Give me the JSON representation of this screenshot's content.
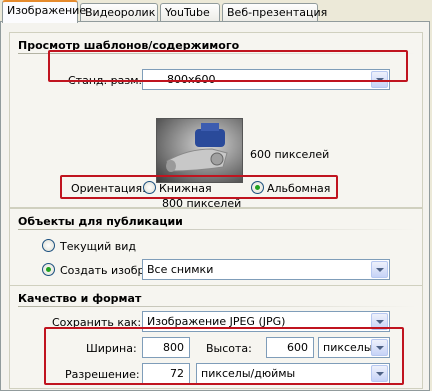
{
  "tabs": [
    {
      "label": "Изображение",
      "active": true
    },
    {
      "label": "Видеоролик",
      "active": false
    },
    {
      "label": "YouTube",
      "active": false
    },
    {
      "label": "Веб-презентация",
      "active": false
    }
  ],
  "preview": {
    "title": "Просмотр шаблонов/содержимого",
    "size_label": "Станд. разм.:",
    "size_value": "800x600",
    "height_text": "600 пикселей",
    "width_text": "800 пикселей",
    "orientation_label": "Ориентация:",
    "portrait": "Книжная",
    "landscape": "Альбомная",
    "selected": "Альбомная"
  },
  "publish": {
    "title": "Объекты для публикации",
    "current_view": "Текущий вид",
    "create_images": "Создать изобра",
    "selected": "Создать изобра",
    "scope_value": "Все снимки"
  },
  "quality": {
    "title": "Качество и формат",
    "save_as_label": "Сохранить как:",
    "save_as_value": "Изображение JPEG (JPG)",
    "width_label": "Ширина:",
    "width_value": "800",
    "height_label": "Высота:",
    "height_value": "600",
    "units_value": "пикселы",
    "resolution_label": "Разрешение:",
    "resolution_value": "72",
    "resolution_units_value": "пикселы/дюймы"
  },
  "colors": {
    "highlight": "#c0141f",
    "tab_accent": "#e68b2c",
    "radio_dot": "#21a121"
  }
}
